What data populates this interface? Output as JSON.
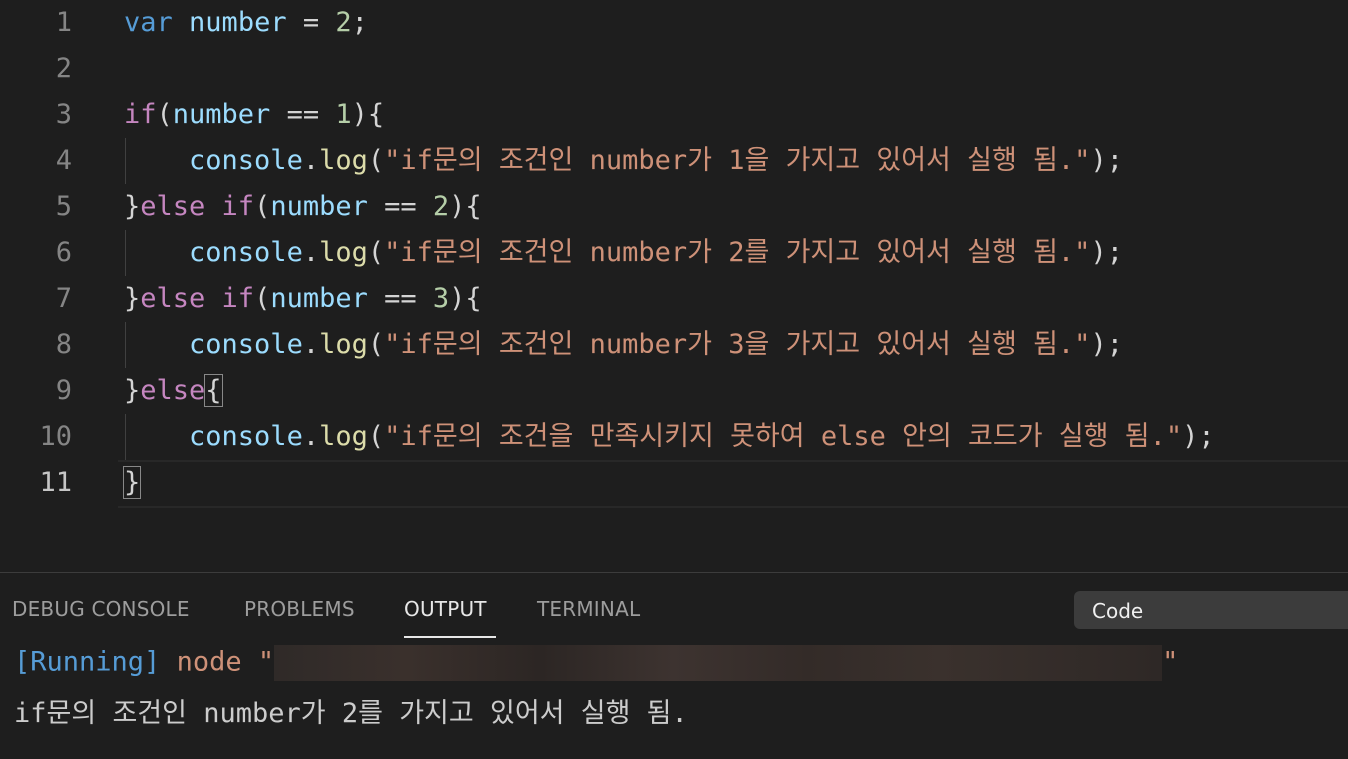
{
  "editor": {
    "lines": [
      {
        "n": "1"
      },
      {
        "n": "2"
      },
      {
        "n": "3"
      },
      {
        "n": "4"
      },
      {
        "n": "5"
      },
      {
        "n": "6"
      },
      {
        "n": "7"
      },
      {
        "n": "8"
      },
      {
        "n": "9"
      },
      {
        "n": "10"
      },
      {
        "n": "11"
      }
    ],
    "tokens": {
      "var": "var",
      "number": "number",
      "eq": " = ",
      "two": "2",
      "semi": ";",
      "if": "if",
      "else": "else",
      "else_if": "else if",
      "eqeq": " == ",
      "one": "1",
      "three": "3",
      "console": "console",
      "dot": ".",
      "log": "log",
      "str1": "\"if문의 조건인 number가 1을 가지고 있어서 실행 됨.\"",
      "str2": "\"if문의 조건인 number가 2를 가지고 있어서 실행 됨.\"",
      "str3": "\"if문의 조건인 number가 3을 가지고 있어서 실행 됨.\"",
      "str4": "\"if문의 조건을 만족시키지 못하여 else 안의 코드가 실행 됨.\""
    }
  },
  "panel": {
    "tabs": [
      {
        "label": "DEBUG CONSOLE"
      },
      {
        "label": "PROBLEMS"
      },
      {
        "label": "OUTPUT"
      },
      {
        "label": "TERMINAL"
      }
    ],
    "active_tab": "OUTPUT",
    "output_channel": "Code",
    "output": {
      "running": "[Running]",
      "cmd_prefix": " node \"",
      "cmd_suffix": "\"",
      "result": "if문의 조건인 number가 2를 가지고 있어서 실행 됨."
    }
  }
}
